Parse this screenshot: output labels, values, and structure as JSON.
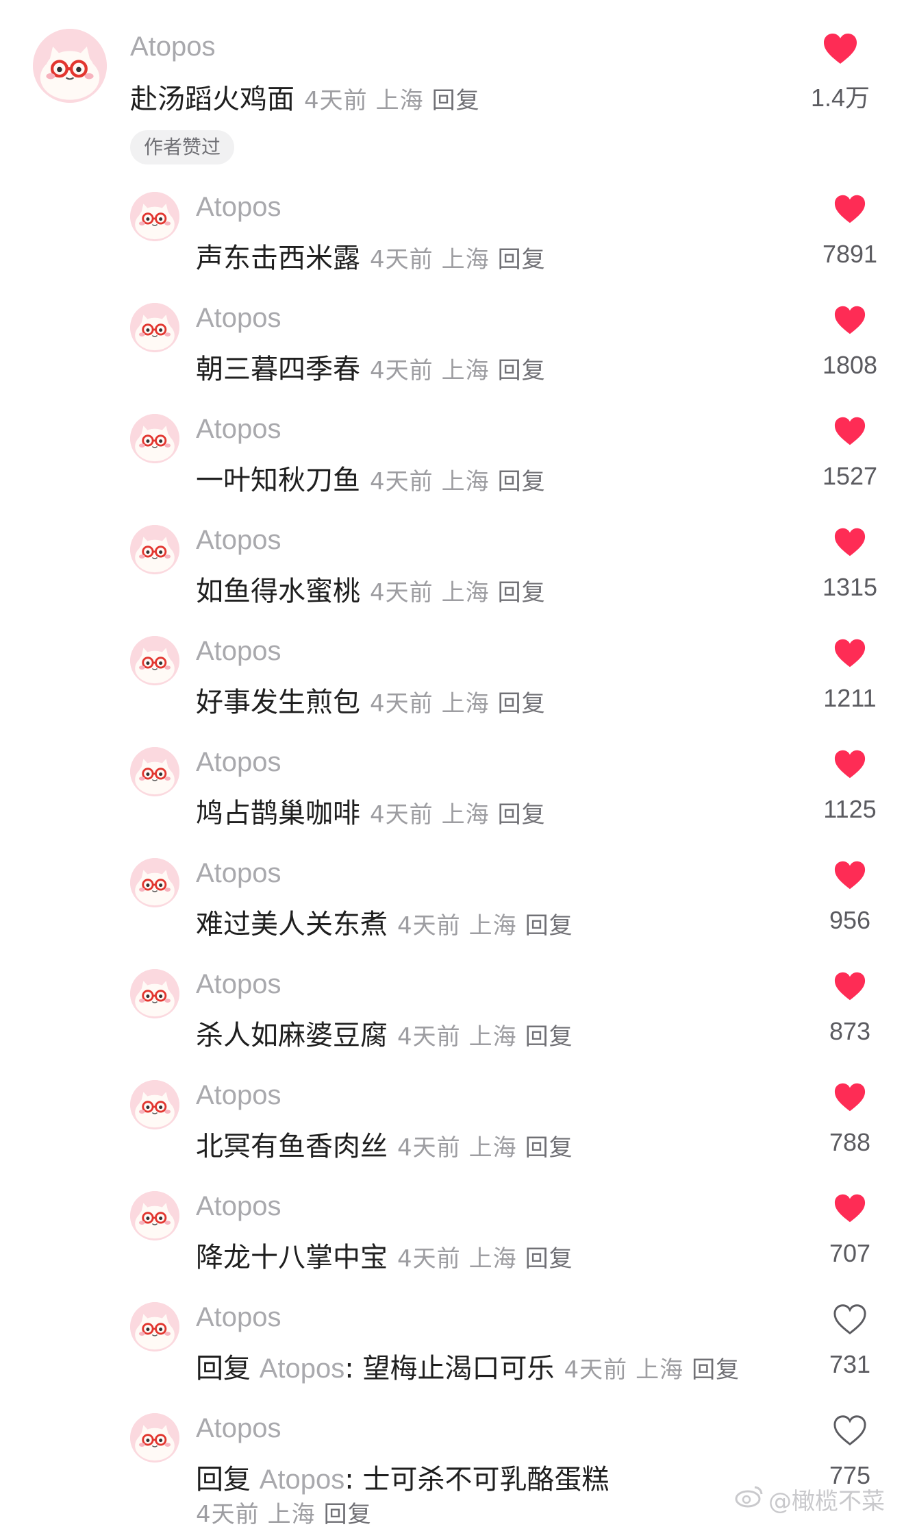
{
  "top": {
    "username": "Atopos",
    "text": "赴汤蹈火鸡面",
    "time": "4天前",
    "location": "上海",
    "reply": "回复",
    "likes": "1.4万",
    "liked": true,
    "badge": "作者赞过"
  },
  "replies": [
    {
      "username": "Atopos",
      "text": "声东击西米露",
      "time": "4天前",
      "location": "上海",
      "reply": "回复",
      "likes": "7891",
      "liked": true
    },
    {
      "username": "Atopos",
      "text": "朝三暮四季春",
      "time": "4天前",
      "location": "上海",
      "reply": "回复",
      "likes": "1808",
      "liked": true
    },
    {
      "username": "Atopos",
      "text": "一叶知秋刀鱼",
      "time": "4天前",
      "location": "上海",
      "reply": "回复",
      "likes": "1527",
      "liked": true
    },
    {
      "username": "Atopos",
      "text": "如鱼得水蜜桃",
      "time": "4天前",
      "location": "上海",
      "reply": "回复",
      "likes": "1315",
      "liked": true
    },
    {
      "username": "Atopos",
      "text": "好事发生煎包",
      "time": "4天前",
      "location": "上海",
      "reply": "回复",
      "likes": "1211",
      "liked": true
    },
    {
      "username": "Atopos",
      "text": "鸠占鹊巢咖啡",
      "time": "4天前",
      "location": "上海",
      "reply": "回复",
      "likes": "1125",
      "liked": true
    },
    {
      "username": "Atopos",
      "text": "难过美人关东煮",
      "time": "4天前",
      "location": "上海",
      "reply": "回复",
      "likes": "956",
      "liked": true
    },
    {
      "username": "Atopos",
      "text": "杀人如麻婆豆腐",
      "time": "4天前",
      "location": "上海",
      "reply": "回复",
      "likes": "873",
      "liked": true
    },
    {
      "username": "Atopos",
      "text": "北冥有鱼香肉丝",
      "time": "4天前",
      "location": "上海",
      "reply": "回复",
      "likes": "788",
      "liked": true
    },
    {
      "username": "Atopos",
      "text": "降龙十八掌中宝",
      "time": "4天前",
      "location": "上海",
      "reply": "回复",
      "likes": "707",
      "liked": true
    },
    {
      "username": "Atopos",
      "reply_prefix": "回复",
      "reply_to": "Atopos",
      "text": ": 望梅止渴口可乐",
      "time": "4天前",
      "location": "上海",
      "reply": "回复",
      "likes": "731",
      "liked": false
    },
    {
      "username": "Atopos",
      "reply_prefix": "回复",
      "reply_to": "Atopos",
      "text": ": 士可杀不可乳酪蛋糕",
      "time": "4天前",
      "location": "上海",
      "reply": "回复",
      "likes": "775",
      "liked": false
    }
  ],
  "watermark": "@橄榄不菜",
  "colors": {
    "liked_heart": "#fe2c55",
    "unliked_heart": "#5b5b60"
  }
}
